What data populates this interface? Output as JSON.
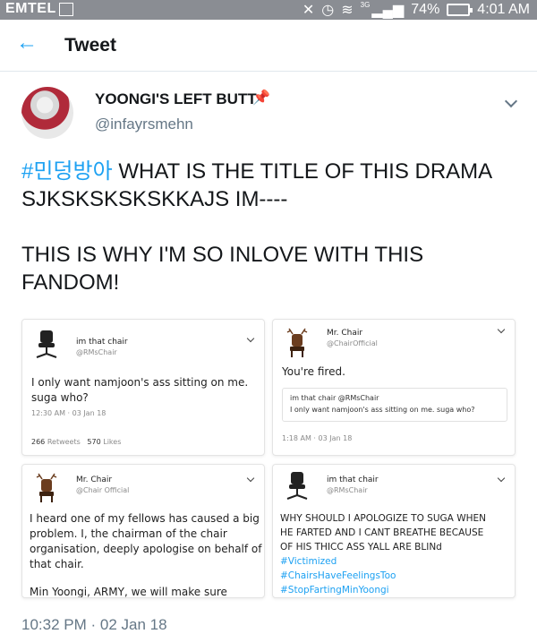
{
  "status_bar": {
    "carrier": "EMTEL",
    "signal_label": "3G",
    "battery_percent": "74%",
    "time": "4:01 AM"
  },
  "header": {
    "title": "Tweet"
  },
  "tweet": {
    "author_name": "YOONGI'S LEFT BUTT",
    "author_handle": "@infayrsmehn",
    "hashtag": "#민덩방아",
    "line1_rest": " WHAT IS THE TITLE OF THIS DRAMA",
    "line2": "SJKSKSKSKSKKAJS IM----",
    "line3": "THIS IS WHY I'M SO INLOVE WITH THIS",
    "line4": "FANDOM!",
    "timestamp": "10:32 PM · 02 Jan 18"
  },
  "embedded_cards": [
    {
      "name": "im that chair",
      "handle": "@RMsChair",
      "body_lines": [
        "I only want namjoon's ass sitting on me.",
        "suga who?"
      ],
      "meta": "12:30 AM · 03 Jan 18",
      "retweets": "266",
      "retweets_label": "Retweets",
      "likes": "570",
      "likes_label": "Likes"
    },
    {
      "name": "Mr. Chair",
      "handle": "@ChairOfficial",
      "body": "You're fired.",
      "quote_author": "im that chair @RMsChair",
      "quote_text": "I only want namjoon's ass sitting on me. suga who?",
      "meta": "1:18 AM · 03 Jan 18"
    },
    {
      "name": "Mr. Chair",
      "handle": "@Chair Official",
      "body_lines": [
        "I heard one of my fellows has caused a big",
        "problem. I, the chairman of the chair",
        "organisation, deeply apologise on behalf of",
        "that chair.",
        "",
        "Min Yoongi, ARMY, we will make sure there's"
      ]
    },
    {
      "name": "im that chair",
      "handle": "@RMsChair",
      "body_lines": [
        "WHY SHOULD I APOLOGIZE TO SUGA WHEN",
        "HE FARTED AND I CANT BREATHE BECAUSE",
        "OF HIS THICC ASS YALL ARE BLINd"
      ],
      "hashtags": [
        "#Victimized",
        "#ChairsHaveFeelingsToo",
        "#StopFartingMinYoongi"
      ]
    }
  ],
  "colors": {
    "accent": "#1da1f2",
    "status_bar": "#8a8d93",
    "muted": "#657786"
  }
}
